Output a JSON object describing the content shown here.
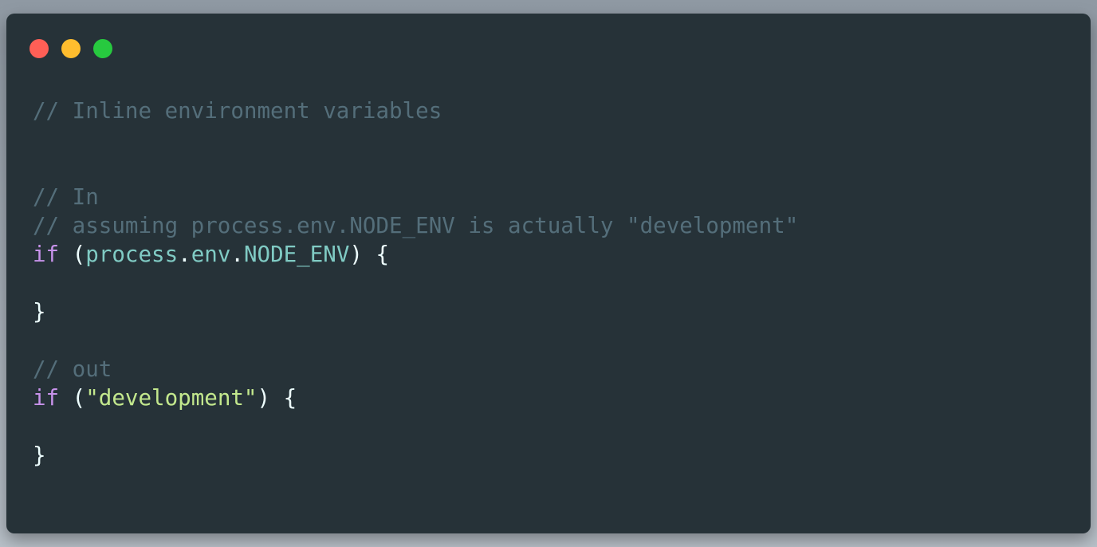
{
  "window": {
    "controls": [
      {
        "name": "close",
        "color": "#ff5f56"
      },
      {
        "name": "minimize",
        "color": "#ffbd2e"
      },
      {
        "name": "maximize",
        "color": "#27c93f"
      }
    ]
  },
  "code": {
    "lines": [
      {
        "tokens": [
          {
            "type": "comment",
            "text": "// Inline environment variables"
          }
        ]
      },
      {
        "tokens": []
      },
      {
        "tokens": []
      },
      {
        "tokens": [
          {
            "type": "comment",
            "text": "// In"
          }
        ]
      },
      {
        "tokens": [
          {
            "type": "comment",
            "text": "// assuming process.env.NODE_ENV is actually \"development\""
          }
        ]
      },
      {
        "tokens": [
          {
            "type": "keyword",
            "text": "if"
          },
          {
            "type": "punct",
            "text": " ("
          },
          {
            "type": "ident",
            "text": "process"
          },
          {
            "type": "punct",
            "text": "."
          },
          {
            "type": "ident",
            "text": "env"
          },
          {
            "type": "punct",
            "text": "."
          },
          {
            "type": "ident",
            "text": "NODE_ENV"
          },
          {
            "type": "punct",
            "text": ") {"
          }
        ]
      },
      {
        "tokens": []
      },
      {
        "tokens": [
          {
            "type": "punct",
            "text": "}"
          }
        ]
      },
      {
        "tokens": []
      },
      {
        "tokens": [
          {
            "type": "comment",
            "text": "// out"
          }
        ]
      },
      {
        "tokens": [
          {
            "type": "keyword",
            "text": "if"
          },
          {
            "type": "punct",
            "text": " ("
          },
          {
            "type": "string",
            "text": "\"development\""
          },
          {
            "type": "punct",
            "text": ") {"
          }
        ]
      },
      {
        "tokens": []
      },
      {
        "tokens": [
          {
            "type": "punct",
            "text": "}"
          }
        ]
      }
    ]
  }
}
